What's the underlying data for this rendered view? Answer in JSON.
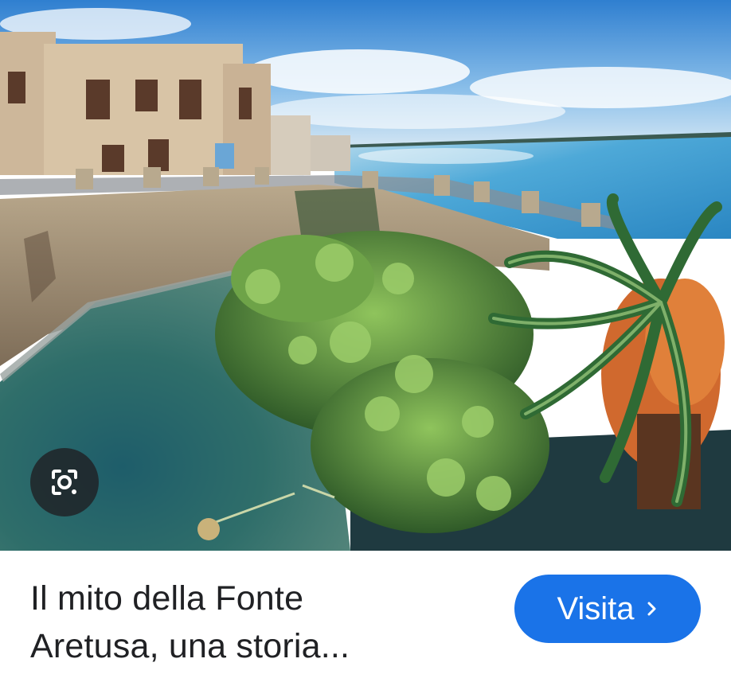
{
  "hero_image": {
    "subject": "Fonte Aretusa, Ortigia seafront with papyrus spring and palm tree"
  },
  "lens_button": {
    "icon": "lens-camera-icon"
  },
  "result": {
    "title_line_1": "Il mito della Fonte",
    "title_line_2": "Aretusa, una storia..."
  },
  "visit_button": {
    "label": "Visita",
    "icon": "chevron-right-icon",
    "color": "#1a73e8"
  },
  "colors": {
    "sky": "#3f8fd6",
    "sea": "#4ea9d8",
    "pool": "#2f6e6a",
    "text": "#202124"
  }
}
